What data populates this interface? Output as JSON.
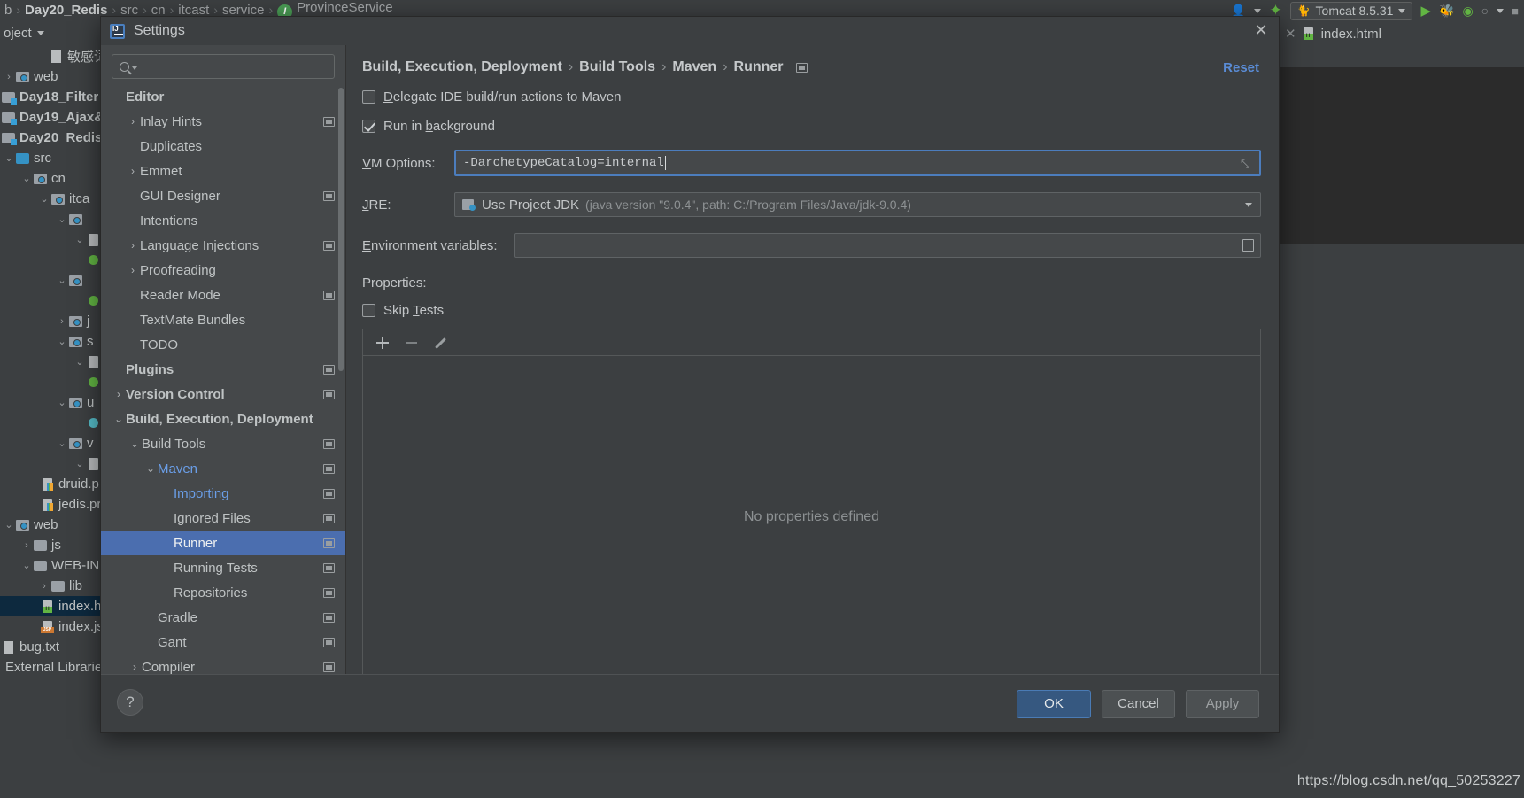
{
  "ide": {
    "breadcrumb": [
      {
        "label": "b",
        "bold": false
      },
      {
        "label": "Day20_Redis",
        "bold": true
      },
      {
        "label": "src",
        "bold": false
      },
      {
        "label": "cn",
        "bold": false
      },
      {
        "label": "itcast",
        "bold": false
      },
      {
        "label": "service",
        "bold": false
      },
      {
        "label": "ProvinceService",
        "bold": false
      }
    ],
    "run_config": "Tomcat 8.5.31",
    "project_panel_title": "oject",
    "editor_tab": "index.html",
    "project_tree": [
      {
        "label": "敏感词汇",
        "indent": 4,
        "arrow": "",
        "icon": "txt",
        "bold": false
      },
      {
        "label": "web",
        "indent": 1,
        "arrow": "›",
        "icon": "pkg",
        "bold": false
      },
      {
        "label": "Day18_Filter",
        "indent": 0,
        "arrow": "",
        "icon": "module",
        "bold": true
      },
      {
        "label": "Day19_Ajax&",
        "indent": 0,
        "arrow": "",
        "icon": "module",
        "bold": true
      },
      {
        "label": "Day20_Redis",
        "indent": 0,
        "arrow": "",
        "icon": "module",
        "bold": true
      },
      {
        "label": "src",
        "indent": 1,
        "arrow": "⌄",
        "icon": "src",
        "bold": false
      },
      {
        "label": "cn",
        "indent": 2,
        "arrow": "⌄",
        "icon": "pkg",
        "bold": false
      },
      {
        "label": "itca",
        "indent": 3,
        "arrow": "⌄",
        "icon": "pkg",
        "bold": false
      },
      {
        "label": "",
        "indent": 4,
        "arrow": "⌄",
        "icon": "pkg",
        "bold": false
      },
      {
        "label": "",
        "indent": 5,
        "arrow": "⌄",
        "icon": "file",
        "bold": false
      },
      {
        "label": "",
        "indent": 6,
        "arrow": "",
        "icon": "dot-green",
        "bold": false
      },
      {
        "label": "",
        "indent": 4,
        "arrow": "⌄",
        "icon": "pkg",
        "bold": false
      },
      {
        "label": "",
        "indent": 5,
        "arrow": "",
        "icon": "dot-green",
        "bold": false
      },
      {
        "label": "j",
        "indent": 3,
        "arrow": "›",
        "icon": "pkg",
        "bold": false
      },
      {
        "label": "s",
        "indent": 3,
        "arrow": "⌄",
        "icon": "pkg",
        "bold": false
      },
      {
        "label": "",
        "indent": 4,
        "arrow": "⌄",
        "icon": "file",
        "bold": false
      },
      {
        "label": "",
        "indent": 5,
        "arrow": "",
        "icon": "dot-green",
        "bold": false
      },
      {
        "label": "u",
        "indent": 3,
        "arrow": "⌄",
        "icon": "pkg",
        "bold": false
      },
      {
        "label": "",
        "indent": 4,
        "arrow": "",
        "icon": "dot-green",
        "bold": false
      },
      {
        "label": "v",
        "indent": 3,
        "arrow": "⌄",
        "icon": "pkg",
        "bold": false
      },
      {
        "label": "",
        "indent": 4,
        "arrow": "⌄",
        "icon": "file",
        "bold": false
      },
      {
        "label": "druid.p",
        "indent": 4,
        "arrow": "",
        "icon": "props",
        "bold": false
      },
      {
        "label": "jedis.pr",
        "indent": 4,
        "arrow": "",
        "icon": "props",
        "bold": false
      },
      {
        "label": "web",
        "indent": 1,
        "arrow": "⌄",
        "icon": "pkg",
        "bold": false
      },
      {
        "label": "js",
        "indent": 2,
        "arrow": "›",
        "icon": "folder",
        "bold": false
      },
      {
        "label": "WEB-IN",
        "indent": 2,
        "arrow": "⌄",
        "icon": "folder",
        "bold": false
      },
      {
        "label": "lib",
        "indent": 3,
        "arrow": "›",
        "icon": "folder",
        "bold": false
      },
      {
        "label": "index.h",
        "indent": 4,
        "arrow": "",
        "icon": "html",
        "bold": false,
        "selected": true
      },
      {
        "label": "index.js",
        "indent": 4,
        "arrow": "",
        "icon": "jsp",
        "bold": false
      },
      {
        "label": "bug.txt",
        "indent": 0,
        "arrow": "",
        "icon": "txt",
        "bold": false
      },
      {
        "label": "External Libraries",
        "indent": 0,
        "arrow": "",
        "icon": "",
        "bold": false
      }
    ]
  },
  "dialog": {
    "title": "Settings",
    "close_label": "✕",
    "search": {
      "placeholder": "",
      "value": ""
    },
    "reset_label": "Reset",
    "tree": [
      {
        "label": "Editor",
        "level": 0,
        "arrow": "",
        "bold": true,
        "badge": false
      },
      {
        "label": "Inlay Hints",
        "level": 1,
        "arrow": "›",
        "bold": false,
        "badge": true
      },
      {
        "label": "Duplicates",
        "level": 1,
        "arrow": "",
        "bold": false,
        "badge": false
      },
      {
        "label": "Emmet",
        "level": 1,
        "arrow": "›",
        "bold": false,
        "badge": false
      },
      {
        "label": "GUI Designer",
        "level": 1,
        "arrow": "",
        "bold": false,
        "badge": true
      },
      {
        "label": "Intentions",
        "level": 1,
        "arrow": "",
        "bold": false,
        "badge": false
      },
      {
        "label": "Language Injections",
        "level": 1,
        "arrow": "›",
        "bold": false,
        "badge": true
      },
      {
        "label": "Proofreading",
        "level": 1,
        "arrow": "›",
        "bold": false,
        "badge": false
      },
      {
        "label": "Reader Mode",
        "level": 1,
        "arrow": "",
        "bold": false,
        "badge": true
      },
      {
        "label": "TextMate Bundles",
        "level": 1,
        "arrow": "",
        "bold": false,
        "badge": false
      },
      {
        "label": "TODO",
        "level": 1,
        "arrow": "",
        "bold": false,
        "badge": false
      },
      {
        "label": "Plugins",
        "level": 0,
        "arrow": "",
        "bold": true,
        "badge": true
      },
      {
        "label": "Version Control",
        "level": 0,
        "arrow": "›",
        "bold": true,
        "badge": true
      },
      {
        "label": "Build, Execution, Deployment",
        "level": 0,
        "arrow": "⌄",
        "bold": true,
        "badge": false
      },
      {
        "label": "Build Tools",
        "level": 1,
        "arrow": "⌄",
        "bold": false,
        "badge": true
      },
      {
        "label": "Maven",
        "level": 2,
        "arrow": "⌄",
        "bold": false,
        "badge": true,
        "blue": true
      },
      {
        "label": "Importing",
        "level": 3,
        "arrow": "",
        "bold": false,
        "badge": true,
        "blue": true
      },
      {
        "label": "Ignored Files",
        "level": 3,
        "arrow": "",
        "bold": false,
        "badge": true
      },
      {
        "label": "Runner",
        "level": 3,
        "arrow": "",
        "bold": false,
        "badge": true,
        "selected": true
      },
      {
        "label": "Running Tests",
        "level": 3,
        "arrow": "",
        "bold": false,
        "badge": true
      },
      {
        "label": "Repositories",
        "level": 3,
        "arrow": "",
        "bold": false,
        "badge": true
      },
      {
        "label": "Gradle",
        "level": 2,
        "arrow": "",
        "bold": false,
        "badge": true
      },
      {
        "label": "Gant",
        "level": 2,
        "arrow": "",
        "bold": false,
        "badge": true
      },
      {
        "label": "Compiler",
        "level": 1,
        "arrow": "›",
        "bold": false,
        "badge": true
      }
    ],
    "breadcrumb": [
      "Build, Execution, Deployment",
      "Build Tools",
      "Maven",
      "Runner"
    ],
    "breadcrumb_sep": "›",
    "checkboxes": [
      {
        "label_pre": "D",
        "label_post": "elegate IDE build/run actions to Maven",
        "checked": false
      },
      {
        "label_pre": "",
        "label_post": "Run in background",
        "checked": true,
        "mnemonic": "b",
        "split": "Run in ",
        "rest": "ackground"
      }
    ],
    "vm_options": {
      "label_pre": "VM",
      "label": "VM Options:",
      "value": "-DarchetypeCatalog=internal",
      "expand_icon": "⤡"
    },
    "jre": {
      "label": "JRE:",
      "value": "Use Project JDK",
      "detail": "(java version \"9.0.4\", path: C:/Program Files/Java/jdk-9.0.4)"
    },
    "env": {
      "label": "Environment variables:",
      "value": ""
    },
    "properties": {
      "section_label": "Properties:",
      "skip_tests_label": "Skip Tests",
      "skip_tests_checked": false,
      "toolbar": [
        "add",
        "remove",
        "edit"
      ],
      "empty_text": "No properties defined"
    },
    "buttons": {
      "help": "?",
      "ok": "OK",
      "cancel": "Cancel",
      "apply": "Apply"
    }
  },
  "watermark": "https://blog.csdn.net/qq_50253227"
}
